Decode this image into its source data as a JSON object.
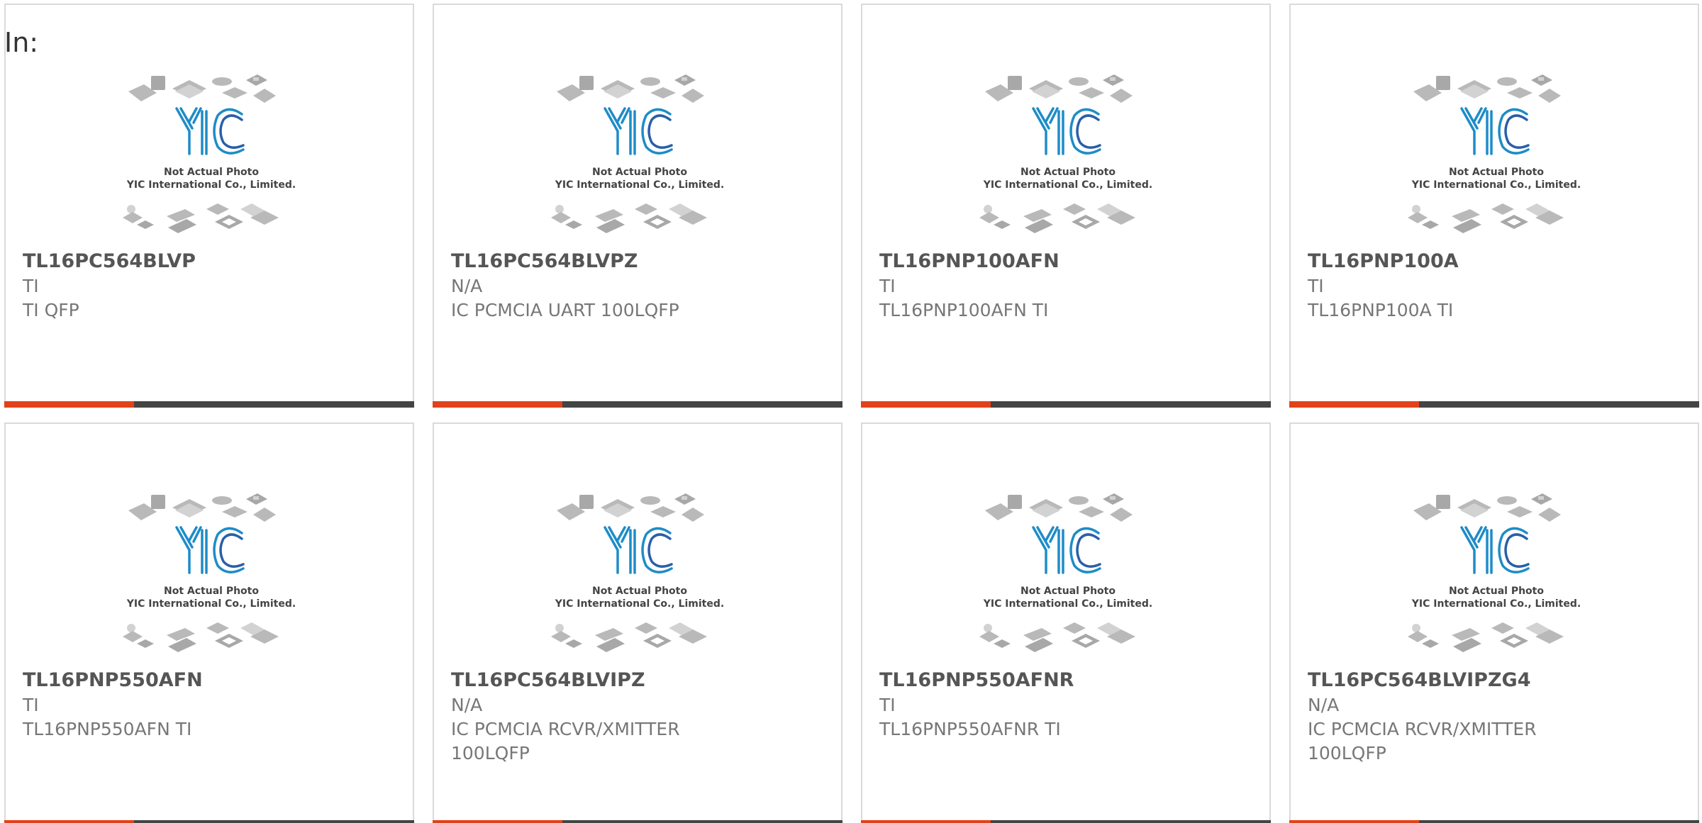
{
  "prefix_label": "In:",
  "placeholder_image": {
    "caption_line1": "Not Actual Photo",
    "caption_line2": "YIC International Co., Limited.",
    "logo_letters": "YIC",
    "logo_color": "#1e8cc8"
  },
  "accent_color": "#e2421a",
  "bar_color": "#444444",
  "products": [
    {
      "part": "TL16PC564BLVP",
      "maker": "TI",
      "desc_line1": "TI QFP",
      "desc_line2": ""
    },
    {
      "part": "TL16PC564BLVPZ",
      "maker": "N/A",
      "desc_line1": "IC PCMCIA UART 100LQFP",
      "desc_line2": ""
    },
    {
      "part": "TL16PNP100AFN",
      "maker": "TI",
      "desc_line1": "TL16PNP100AFN TI",
      "desc_line2": ""
    },
    {
      "part": "TL16PNP100A",
      "maker": "TI",
      "desc_line1": "TL16PNP100A TI",
      "desc_line2": ""
    },
    {
      "part": "TL16PNP550AFN",
      "maker": "TI",
      "desc_line1": "TL16PNP550AFN TI",
      "desc_line2": ""
    },
    {
      "part": "TL16PC564BLVIPZ",
      "maker": "N/A",
      "desc_line1": "IC PCMCIA RCVR/XMITTER",
      "desc_line2": "100LQFP"
    },
    {
      "part": "TL16PNP550AFNR",
      "maker": "TI",
      "desc_line1": "TL16PNP550AFNR TI",
      "desc_line2": ""
    },
    {
      "part": "TL16PC564BLVIPZG4",
      "maker": "N/A",
      "desc_line1": "IC PCMCIA RCVR/XMITTER",
      "desc_line2": "100LQFP"
    }
  ]
}
